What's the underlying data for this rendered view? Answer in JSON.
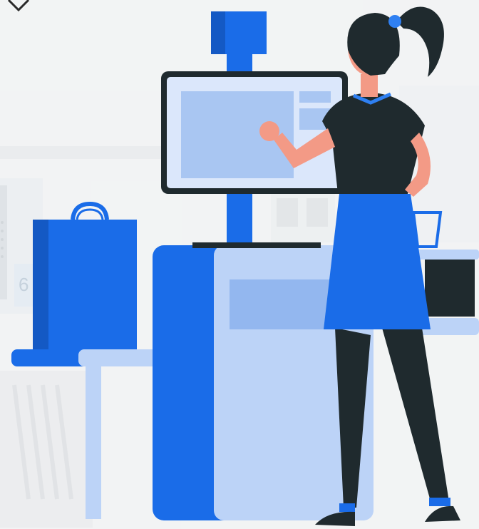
{
  "scene": {
    "subject": "self-checkout-kiosk-illustration",
    "background_digit": "6"
  },
  "colors": {
    "background": "#f4f5f6",
    "primary_blue": "#1a6ce8",
    "mid_blue": "#2f80f2",
    "light_blue": "#bcd3f7",
    "pale_blue": "#dbe7fb",
    "dark": "#1f2a2e",
    "skin": "#f39a86"
  }
}
